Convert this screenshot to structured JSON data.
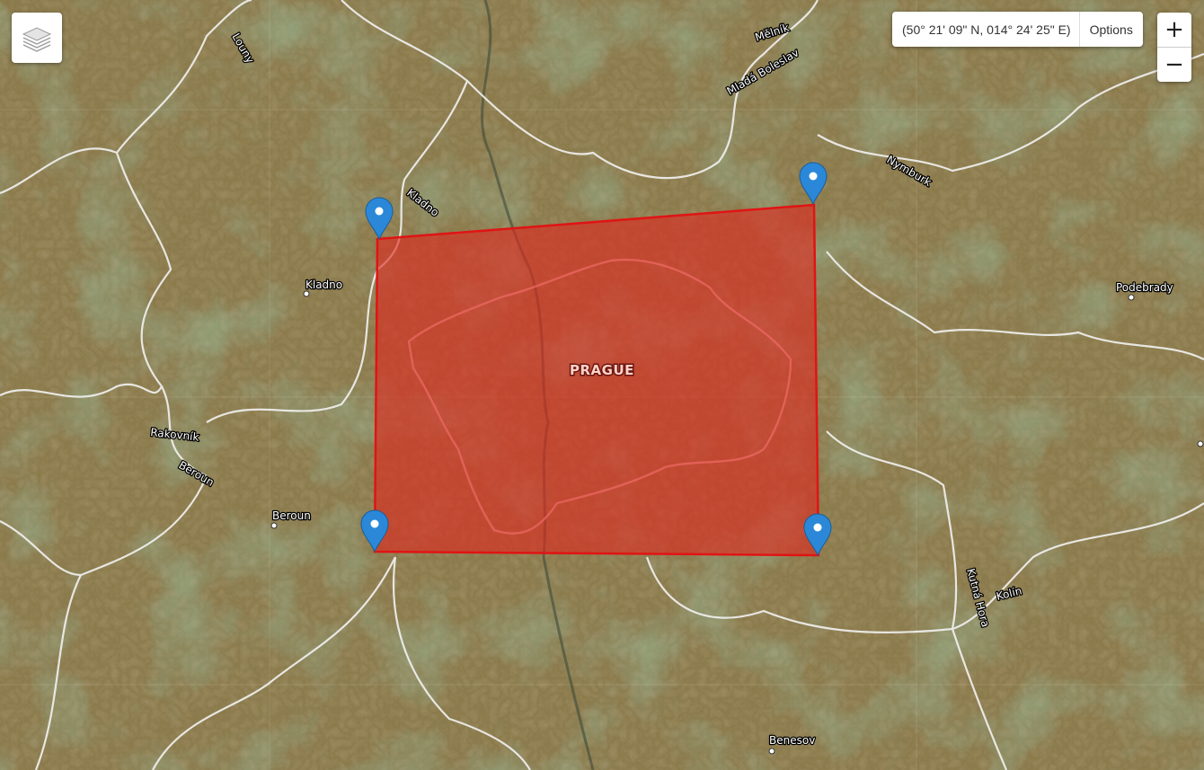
{
  "map": {
    "coordinates": "(50° 21' 09\" N, 014° 24' 25\" E)",
    "options_label": "Options",
    "zoom_in": "+",
    "zoom_out": "−",
    "layers_icon": "layers-icon",
    "polygon": {
      "fill": "#e0281e",
      "stroke": "#e01414",
      "opacity": 0.62
    },
    "marker_color": "#2b88d8",
    "labels": {
      "prague": "PRAGUE",
      "kladno_city": "Kladno",
      "kladno_district": "Kladno",
      "louny": "Louny",
      "melnik": "Mělník",
      "mlada_boleslav": "Mladá Boleslav",
      "nymburk": "Nymburk",
      "podebrady": "Podebrady",
      "rakovnik": "Rakovník",
      "beroun_district": "Beroun",
      "beroun_city": "Beroun",
      "kolin": "Kolín",
      "kutna_hora": "Kutná Hora",
      "benesov": "Benesov"
    }
  }
}
